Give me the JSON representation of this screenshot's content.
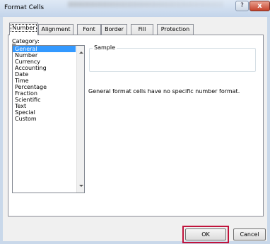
{
  "window": {
    "title": "Format Cells",
    "help_label": "?",
    "close_label": "x"
  },
  "tabs": [
    {
      "label": "Number"
    },
    {
      "label": "Alignment"
    },
    {
      "label": "Font"
    },
    {
      "label": "Border"
    },
    {
      "label": "Fill"
    },
    {
      "label": "Protection"
    }
  ],
  "category": {
    "label_accel": "C",
    "label_rest": "ategory:",
    "items": [
      {
        "label": "General"
      },
      {
        "label": "Number"
      },
      {
        "label": "Currency"
      },
      {
        "label": "Accounting"
      },
      {
        "label": "Date"
      },
      {
        "label": "Time"
      },
      {
        "label": "Percentage"
      },
      {
        "label": "Fraction"
      },
      {
        "label": "Scientific"
      },
      {
        "label": "Text"
      },
      {
        "label": "Special"
      },
      {
        "label": "Custom"
      }
    ],
    "selected": "General"
  },
  "sample": {
    "legend": "Sample"
  },
  "description": "General format cells have no specific number format.",
  "buttons": {
    "ok_label": "OK",
    "cancel_label": "Cancel"
  },
  "colors": {
    "selection": "#3399ff",
    "highlight_box": "#c0143c",
    "close_button": "#c6432b"
  }
}
